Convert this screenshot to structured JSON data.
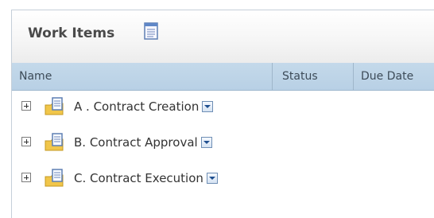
{
  "panel": {
    "title": "Work Items",
    "title_icon": "notepad-icon"
  },
  "grid": {
    "columns": [
      "Name",
      "Status",
      "Due Date"
    ],
    "rows": [
      {
        "label": "A . Contract Creation",
        "status": "",
        "due_date": "",
        "icon": "folder-document-icon"
      },
      {
        "label": "B. Contract Approval",
        "status": "",
        "due_date": "",
        "icon": "folder-document-icon"
      },
      {
        "label": "C. Contract Execution",
        "status": "",
        "due_date": "",
        "icon": "folder-document-icon"
      }
    ]
  },
  "colors": {
    "header_bg": "#b8d0e5",
    "folder_yellow": "#f2c84b",
    "document_blue": "#6f8fb5"
  }
}
